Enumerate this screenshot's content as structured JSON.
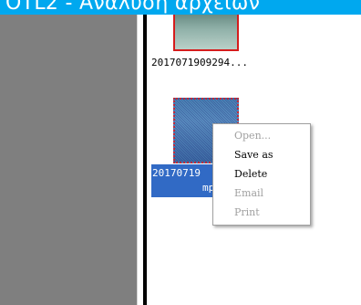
{
  "banner": {
    "text": "OTL2 - Ανάλυση αρχείων",
    "background": "#00a8ef"
  },
  "files": [
    {
      "caption": "2017071909294...",
      "selected": false
    },
    {
      "caption_line1": "20170719",
      "caption_line2": "mp",
      "selected": true
    }
  ],
  "context_menu": {
    "items": [
      {
        "label": "Open...",
        "enabled": false
      },
      {
        "label": "Save as",
        "enabled": true
      },
      {
        "label": "Delete",
        "enabled": true
      },
      {
        "label": "Email",
        "enabled": false
      },
      {
        "label": "Print",
        "enabled": false
      }
    ]
  },
  "colors": {
    "left_panel": "#7f7f7f",
    "selection": "#316ac5",
    "thumb_border": "#d51c1c"
  }
}
